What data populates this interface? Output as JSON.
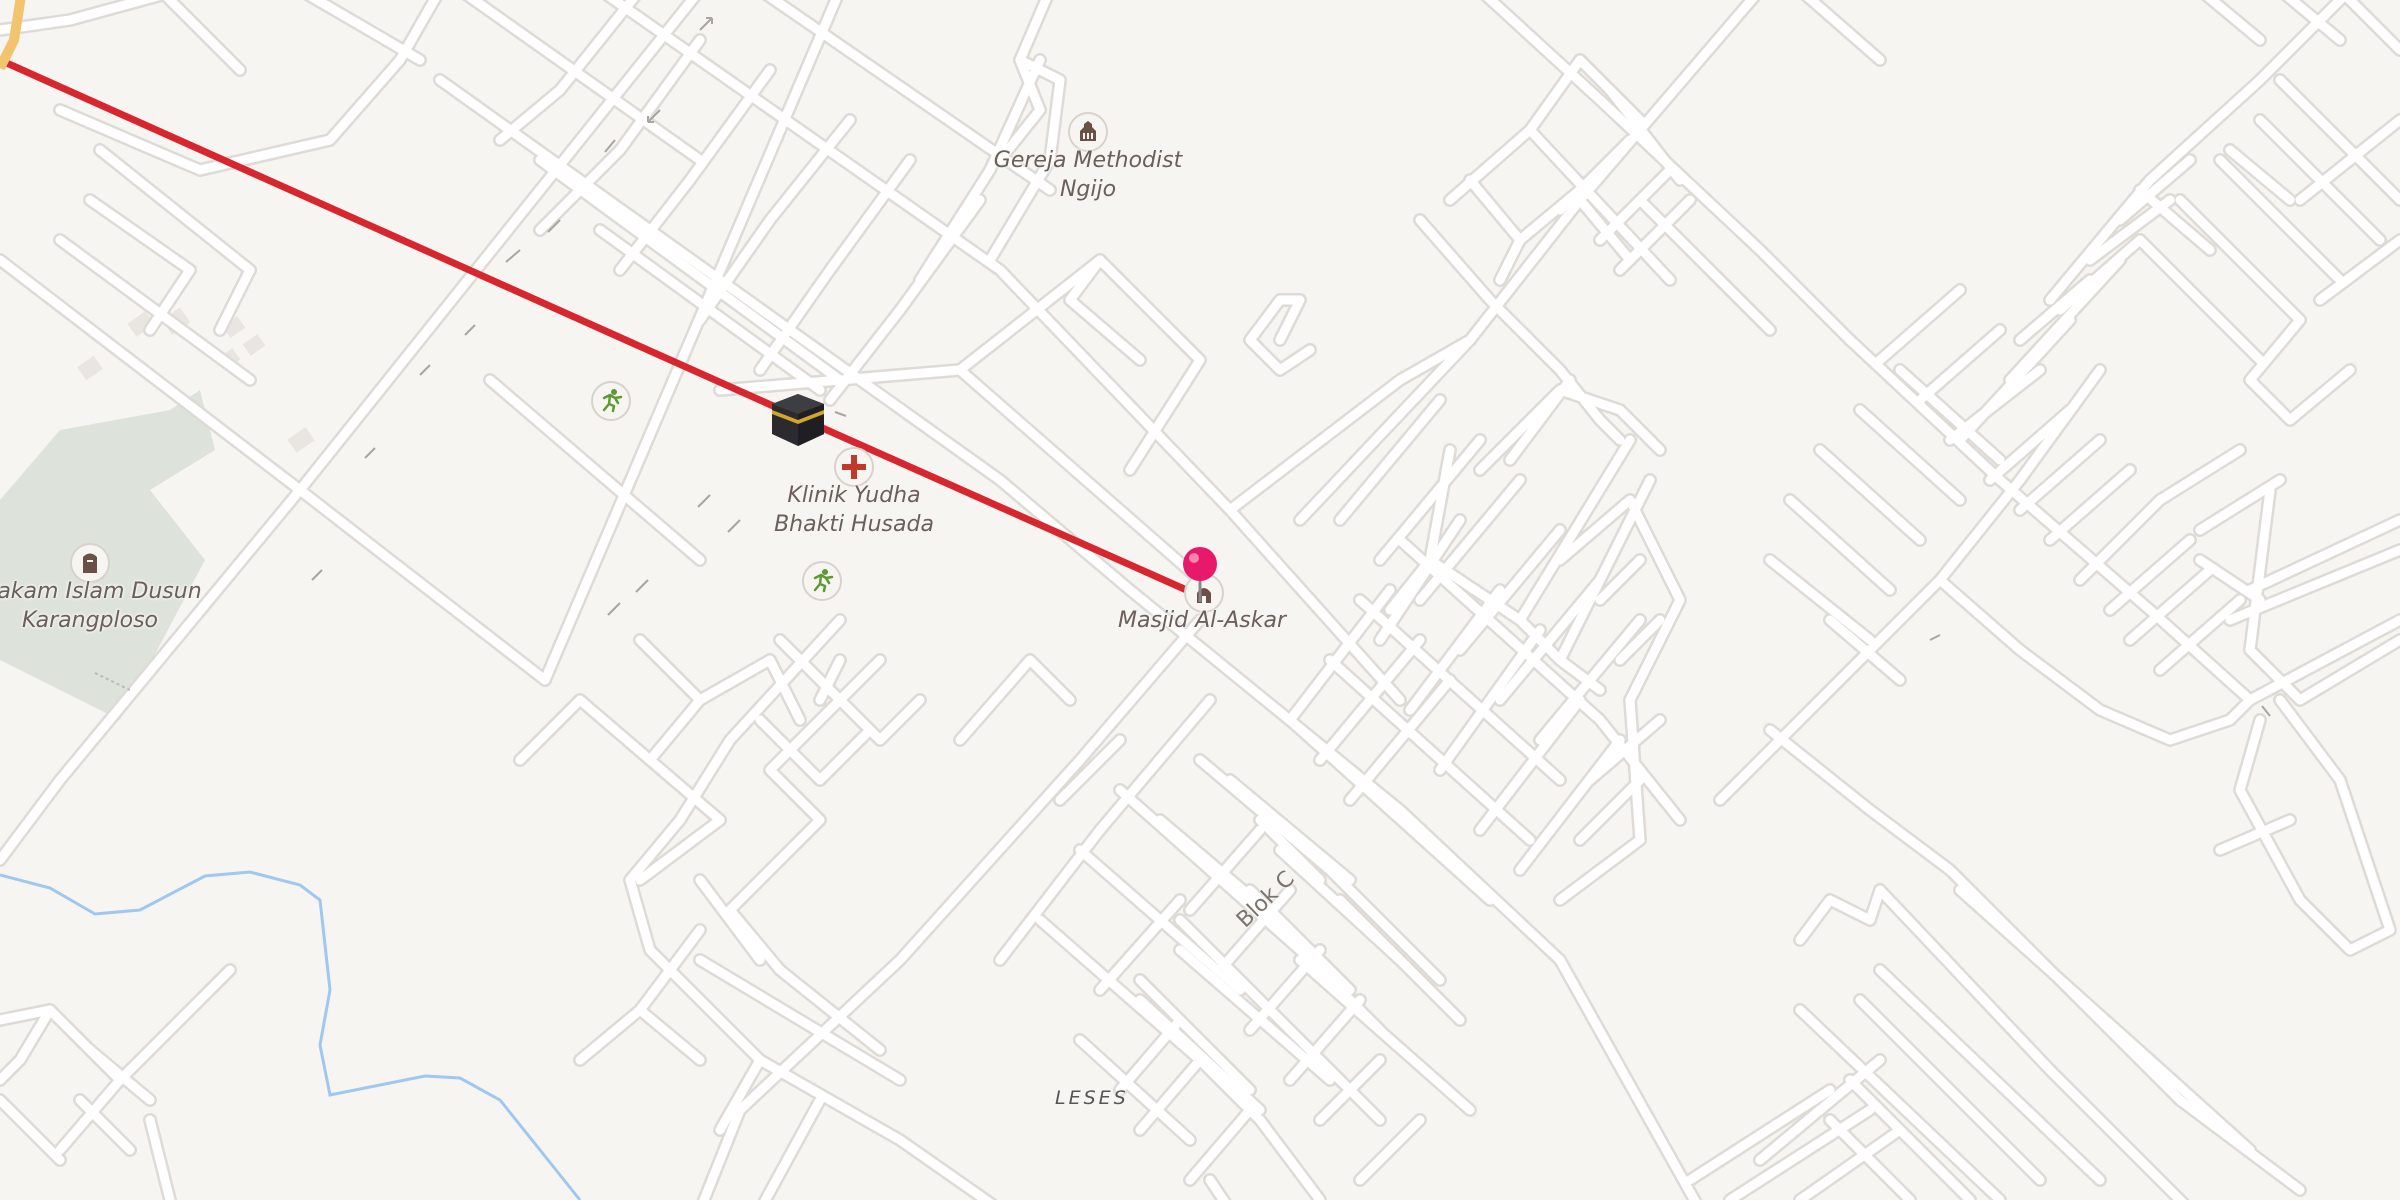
{
  "colors": {
    "background": "#f7f5f2",
    "road_casing": "#dedbd7",
    "road_fill": "#ffffff",
    "building": "#eeebe7",
    "cemetery": "#dde2db",
    "river": "#9ec8ef",
    "route_line": "#d7262d",
    "marker": "#e8186b",
    "poi_icon": "#6b5048",
    "hospital": "#c0392b",
    "sports": "#5d9a32"
  },
  "pois": {
    "church": {
      "name_line1": "Gereja Methodist",
      "name_line2": "Ngijo",
      "icon": "church-icon"
    },
    "clinic": {
      "name_line1": "Klinik Yudha",
      "name_line2": "Bhakti Husada",
      "icon": "hospital-cross-icon"
    },
    "mosque": {
      "name": "Masjid Al-Askar",
      "icon": "mosque-icon"
    },
    "cemetery": {
      "name_line1": "Makam Islam Dusun",
      "name_line2": "Karangploso",
      "icon": "cemetery-icon"
    },
    "sports1": {
      "icon": "running-icon"
    },
    "sports2": {
      "icon": "running-icon"
    },
    "kaaba": {
      "icon": "kaaba-icon"
    },
    "destination": {
      "icon": "location-pin-icon"
    }
  },
  "streets": {
    "blok_c": "Blok C"
  },
  "places": {
    "leses": "LESES"
  }
}
